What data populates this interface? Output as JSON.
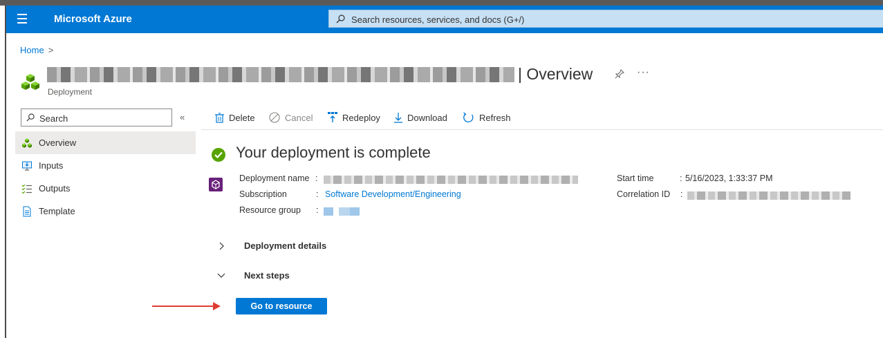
{
  "topbar": {
    "brand": "Microsoft Azure",
    "search_placeholder": "Search resources, services, and docs (G+/)",
    "color": "#0078d4"
  },
  "breadcrumb": {
    "home": "Home",
    "separator": ">"
  },
  "header": {
    "title_suffix": "| Overview",
    "subtitle": "Deployment",
    "more": "···"
  },
  "sidebar": {
    "search_placeholder": "Search",
    "collapse": "«",
    "items": [
      {
        "label": "Overview",
        "icon": "deployment-cubes-icon",
        "selected": true
      },
      {
        "label": "Inputs",
        "icon": "inputs-icon"
      },
      {
        "label": "Outputs",
        "icon": "outputs-list-icon"
      },
      {
        "label": "Template",
        "icon": "template-document-icon"
      }
    ]
  },
  "toolbar": {
    "delete": "Delete",
    "cancel": "Cancel",
    "redeploy": "Redeploy",
    "download": "Download",
    "refresh": "Refresh"
  },
  "status": {
    "text": "Your deployment is complete",
    "color": "#57a300"
  },
  "details": {
    "deployment_name_label": "Deployment name",
    "subscription_label": "Subscription",
    "subscription_value": "Software Development/Engineering",
    "resource_group_label": "Resource group",
    "start_time_label": "Start time",
    "start_time_value": "5/16/2023, 1:33:37 PM",
    "correlation_id_label": "Correlation ID",
    "colon": ":"
  },
  "sections": {
    "deployment_details": "Deployment details",
    "next_steps": "Next steps"
  },
  "actions": {
    "go_to_resource": "Go to resource"
  }
}
